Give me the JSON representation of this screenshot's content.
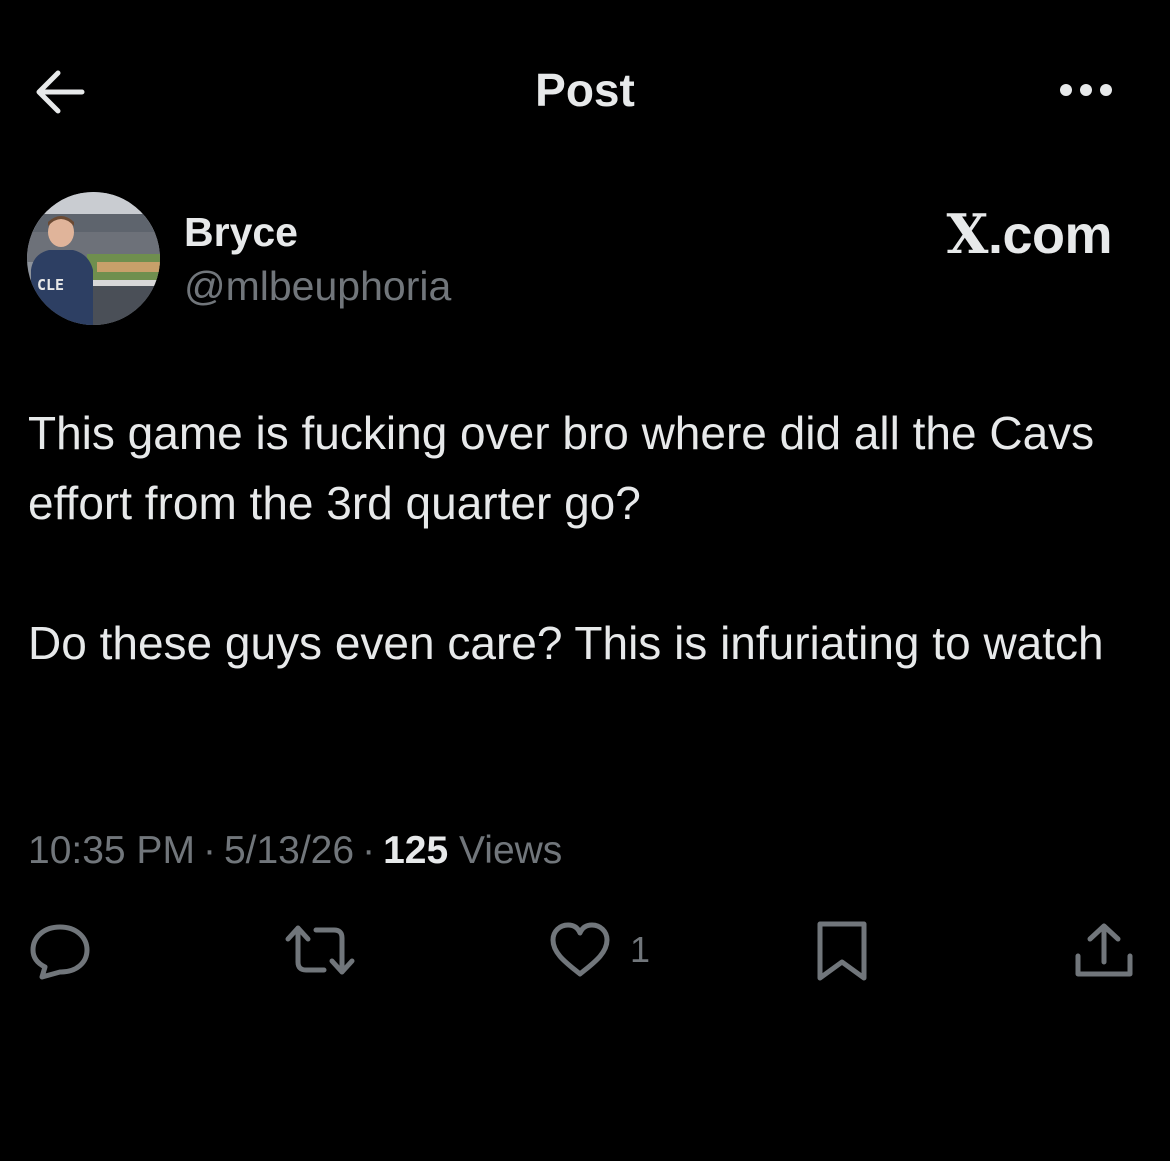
{
  "header": {
    "title": "Post",
    "back_icon": "arrow-left-icon",
    "more_icon": "more-horizontal-icon"
  },
  "author": {
    "name": "Bryce",
    "handle": "@mlbeuphoria",
    "avatar_jersey_text": "CLE"
  },
  "watermark": {
    "x_letter": "X",
    "suffix": ".com"
  },
  "post": {
    "paragraphs": [
      "This game is fucking over bro where did all the Cavs effort from the 3rd quarter go?",
      "Do these guys even care? This is infuriating to watch"
    ]
  },
  "meta": {
    "time": "10:35 PM",
    "separator": "·",
    "date": "5/13/26",
    "views_count": "125",
    "views_label": "Views"
  },
  "actions": {
    "reply_icon": "reply-icon",
    "repost_icon": "repost-icon",
    "like_icon": "heart-icon",
    "like_count": "1",
    "bookmark_icon": "bookmark-icon",
    "share_icon": "share-icon"
  },
  "colors": {
    "background": "#000000",
    "primary_text": "#e7e9ea",
    "secondary_text": "#71767b"
  }
}
